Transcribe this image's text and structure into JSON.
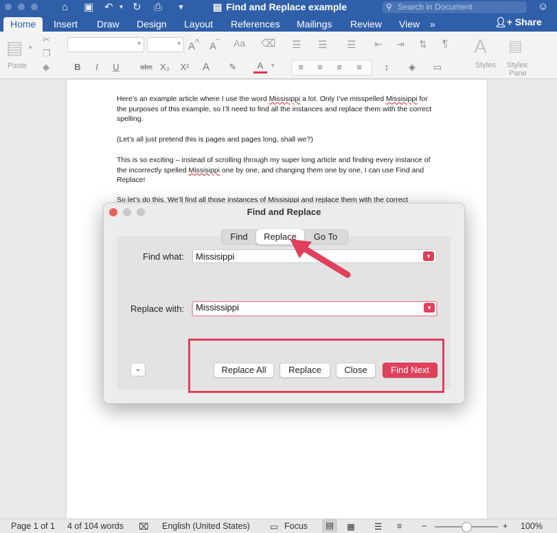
{
  "titlebar": {
    "doc_title": "Find and Replace example",
    "search_placeholder": "Search in Document"
  },
  "tabs": [
    "Home",
    "Insert",
    "Draw",
    "Design",
    "Layout",
    "References",
    "Mailings",
    "Review",
    "View"
  ],
  "tabs_more": "»",
  "share_label": "Share",
  "ribbon": {
    "paste_label": "Paste",
    "styles_label": "Styles",
    "styles_pane_label_1": "Styles",
    "styles_pane_label_2": "Pane",
    "format_buttons": [
      "B",
      "I",
      "U",
      "abc",
      "X₂",
      "X²",
      "A",
      "A"
    ]
  },
  "document": {
    "p1_a": "Here’s an example article where I use the word ",
    "p1_b": "Missisippi",
    "p1_c": " a lot. Only I’ve misspelled ",
    "p1_d": "Missisippi",
    "p1_e": " for the purposes of this example, so I’ll need to find all the instances and replace them with the correct spelling.",
    "p2": "(Let’s all just pretend this is pages and pages long, shall we?)",
    "p3_a": "This is so exciting – instead of scrolling through my super long article and finding every instance of the incorrectly spelled ",
    "p3_b": "Missisippi",
    "p3_c": " one by one, and changing them one by one, I can use Find and Replace!",
    "p4_a": "So let’s do this. We’ll find all those instances of ",
    "p4_b": "Missisippi",
    "p4_c": " and replace them with the correct"
  },
  "dialog": {
    "title": "Find and Replace",
    "tabs": [
      "Find",
      "Replace",
      "Go To"
    ],
    "active_tab": "Replace",
    "find_label": "Find what:",
    "find_value": "Missisippi",
    "replace_label": "Replace with:",
    "replace_value": "Mississippi",
    "disclosure_glyph": "⌄",
    "buttons": {
      "replace_all": "Replace All",
      "replace": "Replace",
      "close": "Close",
      "find_next": "Find Next"
    }
  },
  "statusbar": {
    "page": "Page 1 of 1",
    "words": "4 of 104 words",
    "language": "English (United States)",
    "focus": "Focus",
    "zoom": "100%",
    "zoom_fraction": 0.5
  },
  "colors": {
    "accent": "#2f5fa8",
    "dialog_accent": "#e0405c",
    "annotation": "#e0405c"
  }
}
